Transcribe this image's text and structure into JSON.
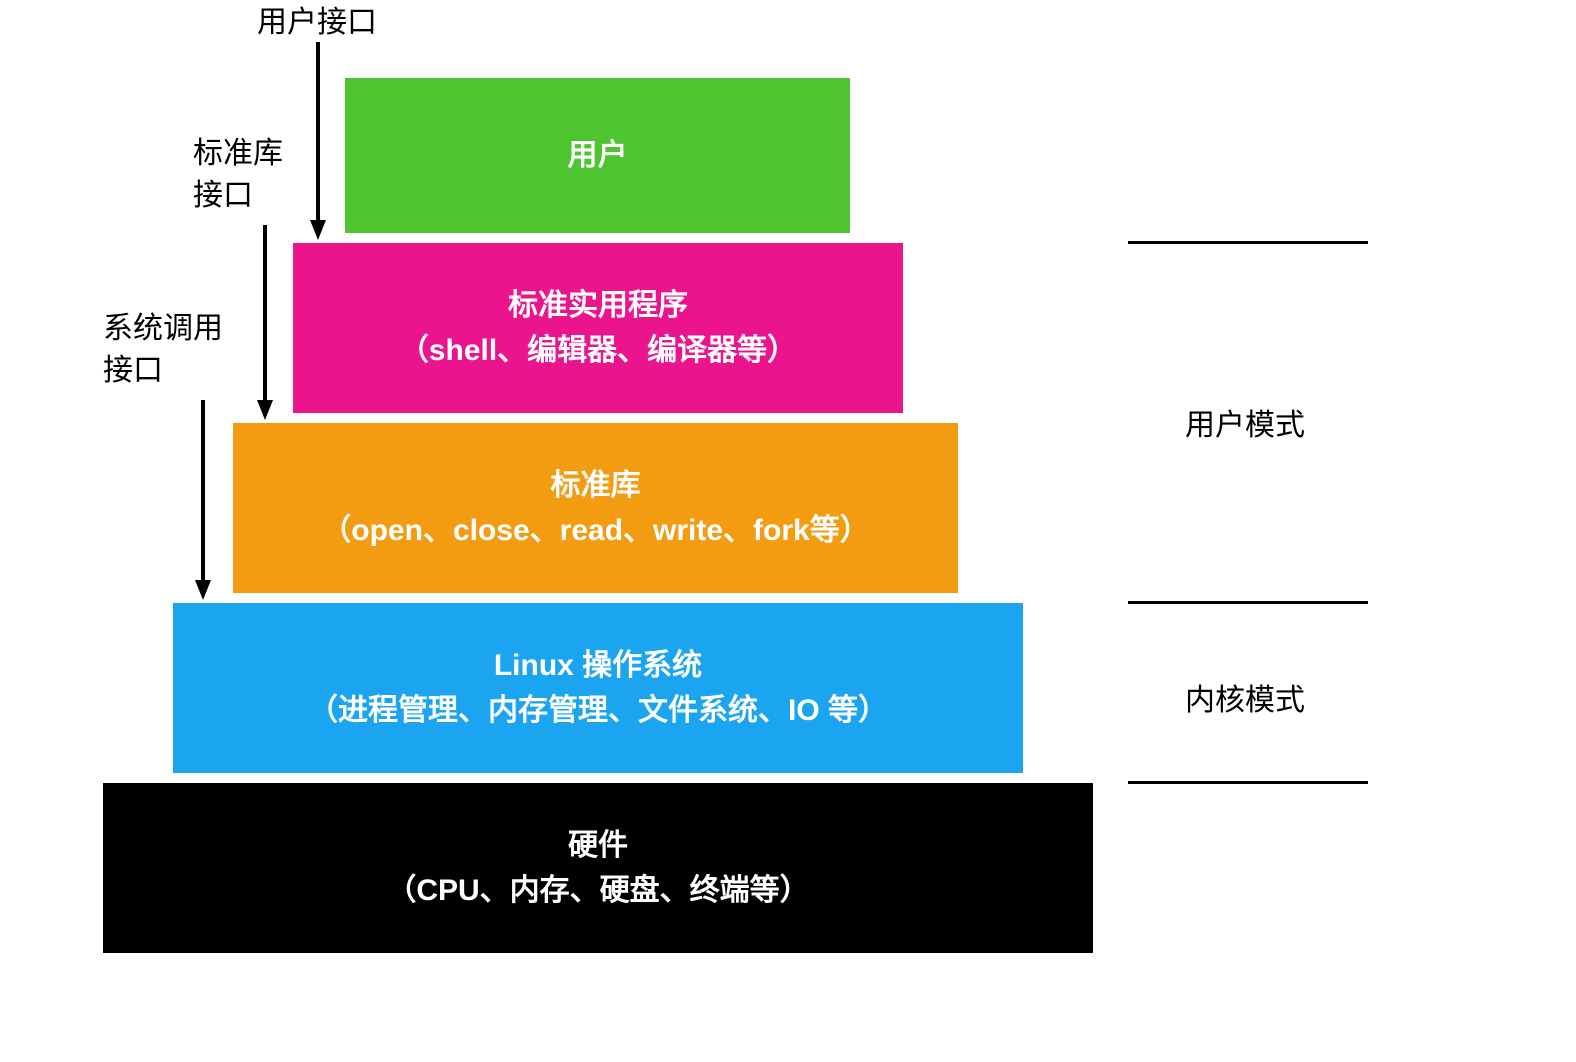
{
  "interfaces": {
    "user_interface": "用户接口",
    "stdlib_interface_line1": "标准库",
    "stdlib_interface_line2": "接口",
    "syscall_interface_line1": "系统调用",
    "syscall_interface_line2": "接口"
  },
  "layers": {
    "user": {
      "title": "用户"
    },
    "utilities": {
      "title": "标准实用程序",
      "subtitle": "（shell、编辑器、编译器等）"
    },
    "stdlib": {
      "title": "标准库",
      "subtitle": "（open、close、read、write、fork等）"
    },
    "os": {
      "title": "Linux 操作系统",
      "subtitle": "（进程管理、内存管理、文件系统、IO 等）"
    },
    "hardware": {
      "title": "硬件",
      "subtitle": "（CPU、内存、硬盘、终端等）"
    }
  },
  "modes": {
    "user_mode": "用户模式",
    "kernel_mode": "内核模式"
  },
  "colors": {
    "user": "#4EC430",
    "utilities": "#EC148C",
    "stdlib": "#F39C12",
    "os": "#1BA5F1",
    "hardware": "#000000"
  }
}
